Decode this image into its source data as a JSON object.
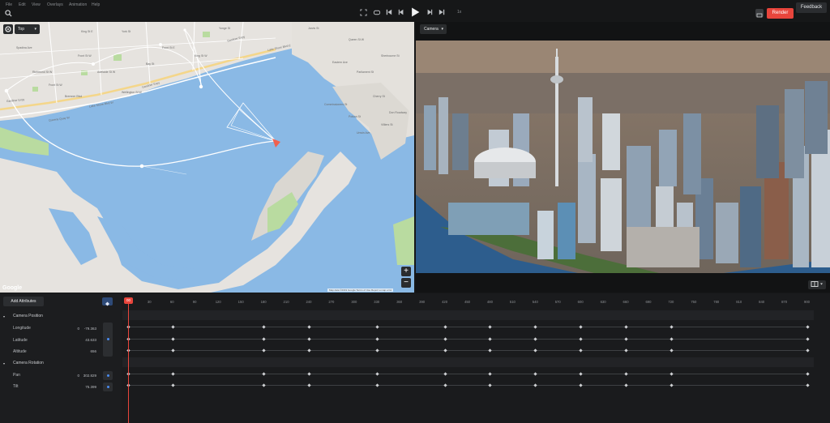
{
  "menu": {
    "items": [
      "File",
      "Edit",
      "View",
      "Overlays",
      "Animation",
      "Help"
    ]
  },
  "transport": {
    "icons": [
      "fullscreen-icon",
      "loop-icon",
      "skip-to-start-icon",
      "step-back-icon",
      "play-icon",
      "step-forward-icon",
      "skip-to-end-icon"
    ],
    "speed_label": "1x"
  },
  "header": {
    "render_label": "Render",
    "feedback_label": "Feedback"
  },
  "map": {
    "view_label": "Top",
    "labels": [
      "Gardiner Expy",
      "Gardiner Expy",
      "Gardiner Expy",
      "Lake Shore Blvd W",
      "Front St W",
      "Front St W",
      "King St W",
      "Queen St W",
      "Adelaide St W",
      "Richmond St W",
      "Wellington St W",
      "Bremner Blvd",
      "Lake Shore Blvd E",
      "Front St E",
      "King St E",
      "Queens Quay W",
      "Spadina Ave",
      "York St",
      "Bay St",
      "Yonge St",
      "Jarvis St",
      "Sherbourne St",
      "Parliament St",
      "Cherry St",
      "Don Roadway",
      "Eastern Ave",
      "Unwin Ave",
      "Commissioners St",
      "Polson St",
      "Villiers St"
    ],
    "google_label": "Google",
    "credit": "Map data ©2019 Google   Terms of Use   Report a map error"
  },
  "camera": {
    "view_label": "Camera"
  },
  "timeline": {
    "add_attributes_label": "Add Attributes",
    "groups": [
      {
        "label": "Camera Position",
        "attributes": [
          {
            "label": "Longitude",
            "unit": "0",
            "value": "-79.363"
          },
          {
            "label": "Latitude",
            "unit": "",
            "value": "43.633"
          },
          {
            "label": "Altitude",
            "unit": "",
            "value": "656"
          }
        ]
      },
      {
        "label": "Camera Rotation",
        "attributes": [
          {
            "label": "Pan",
            "unit": "0",
            "value": "302.829"
          },
          {
            "label": "Tilt",
            "unit": "",
            "value": "75.399"
          }
        ]
      }
    ],
    "playhead_frame": "00",
    "ruler": [
      "00",
      "30",
      "60",
      "90",
      "120",
      "150",
      "180",
      "210",
      "240",
      "270",
      "300",
      "330",
      "360",
      "390",
      "420",
      "450",
      "480",
      "510",
      "540",
      "570",
      "600",
      "630",
      "660",
      "690",
      "720",
      "750",
      "780",
      "810",
      "840",
      "870",
      "900"
    ],
    "keyframe_frames": [
      0,
      60,
      180,
      240,
      330,
      420,
      480,
      540,
      600,
      660,
      720,
      900
    ]
  },
  "colors": {
    "accent": "#e8453c",
    "water": "#8ab9e5",
    "land": "#e6e3df",
    "park": "#b9dba0",
    "key": "#4a8bf0"
  }
}
